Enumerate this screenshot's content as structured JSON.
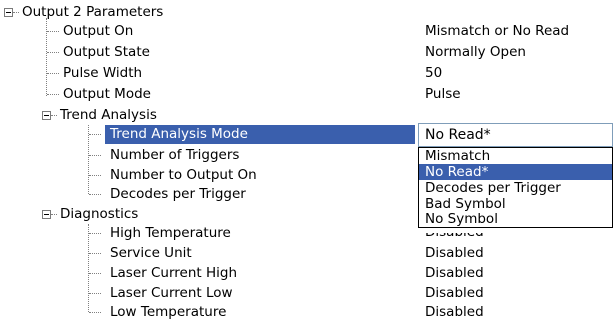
{
  "tree": {
    "output2": {
      "label": "Output 2 Parameters",
      "items": [
        {
          "label": "Output On",
          "value": "Mismatch or No Read"
        },
        {
          "label": "Output State",
          "value": "Normally Open"
        },
        {
          "label": "Pulse Width",
          "value": "50"
        },
        {
          "label": "Output Mode",
          "value": "Pulse"
        }
      ]
    },
    "trend": {
      "label": "Trend Analysis",
      "items": [
        {
          "label": "Trend Analysis Mode"
        },
        {
          "label": "Number of Triggers"
        },
        {
          "label": "Number to Output On"
        },
        {
          "label": "Decodes per Trigger"
        }
      ]
    },
    "diagnostics": {
      "label": "Diagnostics",
      "items": [
        {
          "label": "High Temperature",
          "value": "Disabled"
        },
        {
          "label": "Service Unit",
          "value": "Disabled"
        },
        {
          "label": "Laser Current High",
          "value": "Disabled"
        },
        {
          "label": "Laser Current Low",
          "value": "Disabled"
        },
        {
          "label": "Low Temperature",
          "value": "Disabled"
        }
      ]
    }
  },
  "dropdown": {
    "value": "No Read*",
    "options": [
      "Mismatch",
      "No Read*",
      "Decodes per Trigger",
      "Bad Symbol",
      "No Symbol"
    ],
    "selected_index": 1
  },
  "colors": {
    "selection": "#3a5fad",
    "tree_lines": "#808080"
  }
}
